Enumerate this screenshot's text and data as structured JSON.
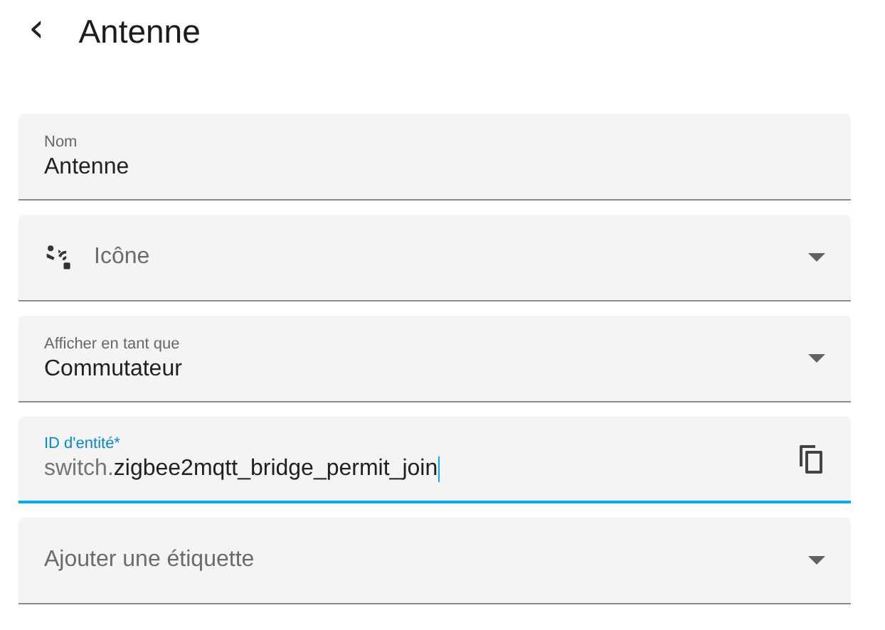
{
  "header": {
    "back": "‹",
    "title": "Antenne"
  },
  "fields": [
    {
      "kind": "text",
      "label": "Nom",
      "value": "Antenne",
      "focused": false
    },
    {
      "kind": "icon-select",
      "placeholder": "Icône",
      "focused": false
    },
    {
      "kind": "select",
      "label": "Afficher en tant que",
      "value": "Commutateur",
      "focused": false
    },
    {
      "kind": "entity",
      "label": "ID d'entité*",
      "prefix": "switch.",
      "value": "zigbee2mqtt_bridge_permit_join",
      "focused": true
    },
    {
      "kind": "select",
      "placeholder": "Ajouter une étiquette",
      "focused": false
    }
  ]
}
